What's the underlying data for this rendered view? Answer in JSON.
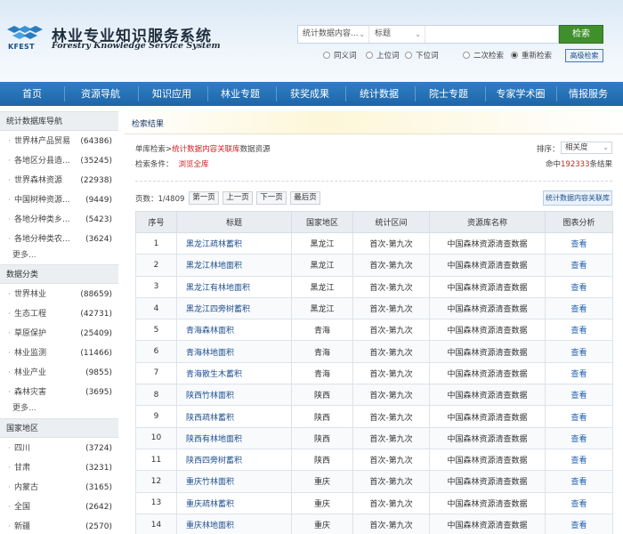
{
  "header": {
    "title": "林业专业知识服务系统",
    "subtitle": "Forestry Knowledge Service System",
    "logo_text": "KFEST"
  },
  "search": {
    "scope": "统计数据内容...",
    "field": "标题",
    "value": "",
    "button": "检索",
    "options": [
      "同义词",
      "上位词",
      "下位词"
    ],
    "modes": [
      "二次检索",
      "重新检索"
    ],
    "selected_mode": "重新检索",
    "advanced": "高级检索"
  },
  "nav": [
    "首页",
    "资源导航",
    "知识应用",
    "林业专题",
    "获奖成果",
    "统计数据",
    "院士专题",
    "专家学术圈",
    "情报服务"
  ],
  "sidebar": {
    "nav_title": "统计数据库导航",
    "nav_items": [
      {
        "label": "世界林产品贸易",
        "count": "(64386)"
      },
      {
        "label": "各地区分县造...",
        "count": "(35245)"
      },
      {
        "label": "世界森林资源",
        "count": "(22938)"
      },
      {
        "label": "中国树种资源...",
        "count": "(9449)"
      },
      {
        "label": "各地分种类乡...",
        "count": "(5423)"
      },
      {
        "label": "各地分种类农...",
        "count": "(3624)"
      }
    ],
    "more1": "更多...",
    "cat_title": "数据分类",
    "cat_items": [
      {
        "label": "世界林业",
        "count": "(88659)"
      },
      {
        "label": "生态工程",
        "count": "(42731)"
      },
      {
        "label": "草原保护",
        "count": "(25409)"
      },
      {
        "label": "林业监测",
        "count": "(11466)"
      },
      {
        "label": "林业产业",
        "count": "(9855)"
      },
      {
        "label": "森林灾害",
        "count": "(3695)"
      }
    ],
    "more2": "更多...",
    "region_title": "国家地区",
    "region_items": [
      {
        "label": "四川",
        "count": "(3724)"
      },
      {
        "label": "甘肃",
        "count": "(3231)"
      },
      {
        "label": "内蒙古",
        "count": "(3165)"
      },
      {
        "label": "全国",
        "count": "(2642)"
      },
      {
        "label": "新疆",
        "count": "(2570)"
      }
    ]
  },
  "main": {
    "tab": "检索结果",
    "crumb_prefix": "单库检索>",
    "crumb_highlight": "统计数据内容关联库",
    "crumb_suffix": "数据资源",
    "condition_label": "检索条件：",
    "condition_value": "浏览全库",
    "sort_label": "排序：",
    "sort_value": "相关度",
    "hits_prefix": "命中",
    "hits_count": "192333",
    "hits_suffix": "条结果",
    "page_info": "页数：1/4809",
    "first": "第一页",
    "prev": "上一页",
    "next": "下一页",
    "last": "最后页",
    "export": "统计数据内容关联库"
  },
  "table": {
    "headers": [
      "序号",
      "标题",
      "国家地区",
      "统计区间",
      "资源库名称",
      "图表分析"
    ],
    "rows": [
      [
        "1",
        "黑龙江疏林蓄积",
        "黑龙江",
        "首次-第九次",
        "中国森林资源清查数据",
        "查看"
      ],
      [
        "2",
        "黑龙江林地面积",
        "黑龙江",
        "首次-第九次",
        "中国森林资源清查数据",
        "查看"
      ],
      [
        "3",
        "黑龙江有林地面积",
        "黑龙江",
        "首次-第九次",
        "中国森林资源清查数据",
        "查看"
      ],
      [
        "4",
        "黑龙江四旁树蓄积",
        "黑龙江",
        "首次-第九次",
        "中国森林资源清查数据",
        "查看"
      ],
      [
        "5",
        "青海森林面积",
        "青海",
        "首次-第九次",
        "中国森林资源清查数据",
        "查看"
      ],
      [
        "6",
        "青海林地面积",
        "青海",
        "首次-第九次",
        "中国森林资源清查数据",
        "查看"
      ],
      [
        "7",
        "青海散生木蓄积",
        "青海",
        "首次-第九次",
        "中国森林资源清查数据",
        "查看"
      ],
      [
        "8",
        "陕西竹林面积",
        "陕西",
        "首次-第九次",
        "中国森林资源清查数据",
        "查看"
      ],
      [
        "9",
        "陕西疏林蓄积",
        "陕西",
        "首次-第九次",
        "中国森林资源清查数据",
        "查看"
      ],
      [
        "10",
        "陕西有林地面积",
        "陕西",
        "首次-第九次",
        "中国森林资源清查数据",
        "查看"
      ],
      [
        "11",
        "陕西四旁树蓄积",
        "陕西",
        "首次-第九次",
        "中国森林资源清查数据",
        "查看"
      ],
      [
        "12",
        "重庆竹林面积",
        "重庆",
        "首次-第九次",
        "中国森林资源清查数据",
        "查看"
      ],
      [
        "13",
        "重庆疏林蓄积",
        "重庆",
        "首次-第九次",
        "中国森林资源清查数据",
        "查看"
      ],
      [
        "14",
        "重庆林地面积",
        "重庆",
        "首次-第九次",
        "中国森林资源清查数据",
        "查看"
      ]
    ]
  }
}
